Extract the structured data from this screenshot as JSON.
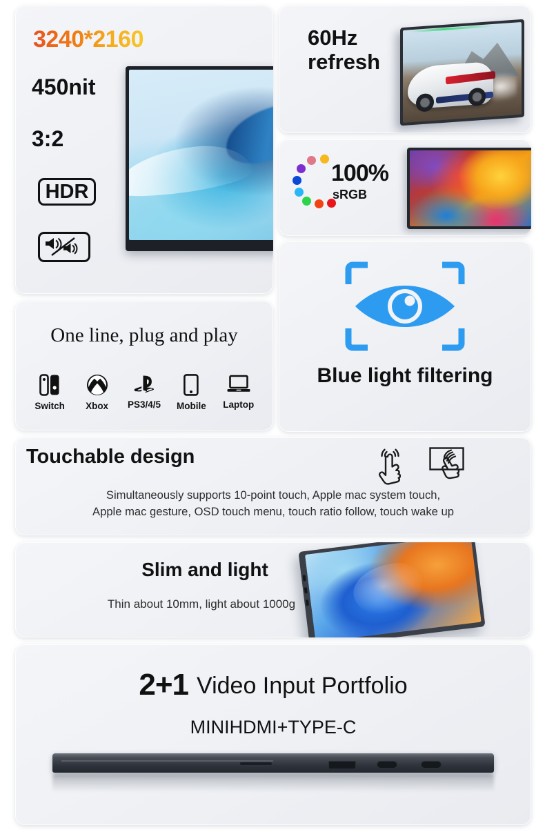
{
  "panels": {
    "resolution": {
      "title": "3240*2160",
      "brightness": "450nit",
      "aspect_ratio": "3:2",
      "hdr_badge": "HDR",
      "speaker_badge_icon": "dual-speaker-icon",
      "monitor_icon": "monitor-blue-wave-wallpaper",
      "gradient_start": "#e8521e",
      "gradient_end": "#f6c829"
    },
    "refresh": {
      "line1": "60Hz",
      "line2": "refresh",
      "monitor_icon": "monitor-racing-car-image"
    },
    "srgb": {
      "value": "100%",
      "label": "sRGB",
      "monitor_icon": "monitor-colorful-paint-wallpaper",
      "dot_colors": [
        "#f5b81d",
        "#e0788a",
        "#7c2fd0",
        "#0b48d8",
        "#29b6f6",
        "#2bd44a",
        "#f24213",
        "#e8151a"
      ]
    },
    "blue_light": {
      "title": "Blue light filtering",
      "icon": "eye-focus-frame-icon",
      "accent_color": "#2d9cf0"
    },
    "plug_play": {
      "title": "One line, plug and play",
      "devices": [
        {
          "label": "Switch",
          "icon": "nintendo-switch-icon"
        },
        {
          "label": "Xbox",
          "icon": "xbox-icon"
        },
        {
          "label": "PS3/4/5",
          "icon": "playstation-icon"
        },
        {
          "label": "Mobile",
          "icon": "mobile-phone-icon"
        },
        {
          "label": "Laptop",
          "icon": "laptop-icon"
        }
      ]
    },
    "touch": {
      "title": "Touchable design",
      "body_line1": "Simultaneously supports 10-point touch, Apple mac system touch,",
      "body_line2": "Apple mac gesture, OSD touch menu, touch ratio follow, touch wake up",
      "icon1": "tap-finger-icon",
      "icon2": "multi-finger-swipe-icon"
    },
    "slim": {
      "title": "Slim and light",
      "subtitle": "Thin about 10mm, light about 1000g",
      "monitor_icon": "monitor-bloom-wallpaper-tilted"
    },
    "video_input": {
      "number": "2+1",
      "heading": "Video Input Portfolio",
      "subtitle": "MINIHDMI+TYPE-C",
      "edge_icon": "monitor-side-edge-ports",
      "ports": [
        "slot-vent",
        "mini-hdmi-port",
        "usb-c-port",
        "usb-c-port"
      ]
    }
  }
}
